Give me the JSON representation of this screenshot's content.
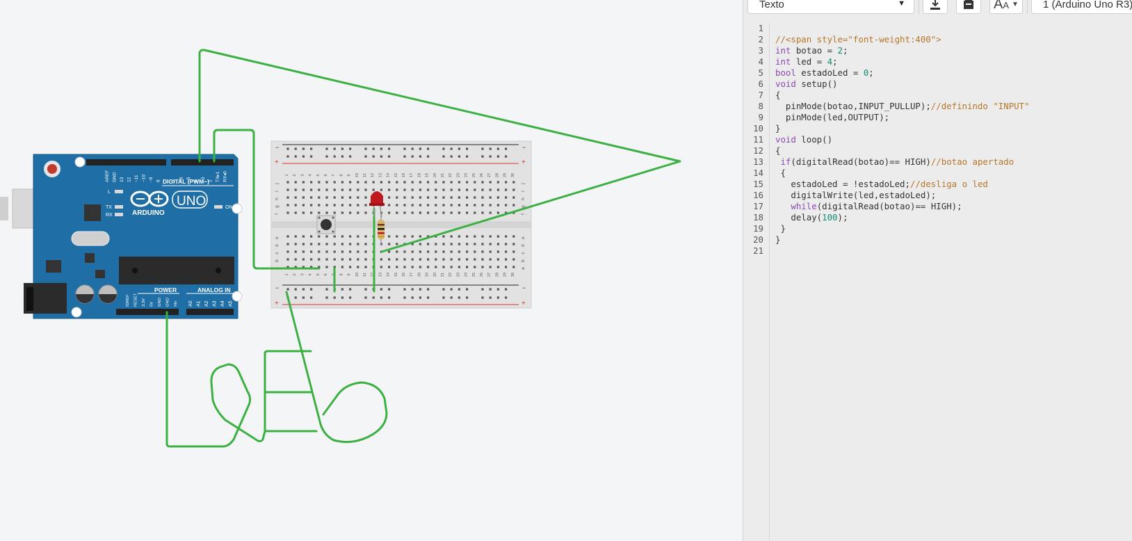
{
  "toolbar": {
    "mode_label": "Texto",
    "device_label": "1 (Arduino Uno R3)",
    "download_icon": "download-icon",
    "upload_icon": "upload-icon",
    "font_icon": "font-size-icon"
  },
  "arduino": {
    "brand": "ARDUINO",
    "model": "UNO",
    "digital_label": "DIGITAL (PWM~)",
    "power_label": "POWER",
    "analog_label": "ANALOG IN",
    "on_label": "ON",
    "l_label": "L",
    "tx_label": "TX",
    "rx_label": "RX",
    "digital_pins": [
      "AREF",
      "GND",
      "13",
      "12",
      "~11",
      "~10",
      "~9",
      "8",
      "7",
      "~6",
      "~5",
      "4",
      "~3",
      "2",
      "TX▸1",
      "RX◂0"
    ],
    "power_pins": [
      "IOREF",
      "RESET",
      "3.3V",
      "5V",
      "GND",
      "GND",
      "Vin"
    ],
    "analog_pins": [
      "A0",
      "A1",
      "A2",
      "A3",
      "A4",
      "A5"
    ]
  },
  "breadboard": {
    "column_numbers": [
      "1",
      "2",
      "3",
      "4",
      "5",
      "6",
      "7",
      "8",
      "9",
      "10",
      "11",
      "12",
      "13",
      "14",
      "15",
      "16",
      "17",
      "18",
      "19",
      "20",
      "21",
      "22",
      "23",
      "24",
      "25",
      "26",
      "27",
      "28",
      "29",
      "30"
    ],
    "top_rows": [
      "j",
      "i",
      "h",
      "g",
      "f"
    ],
    "bottom_rows": [
      "e",
      "d",
      "c",
      "b",
      "a"
    ],
    "plus_label": "+",
    "minus_label": "−"
  },
  "editor": {
    "line_numbers": [
      "1",
      "2",
      "3",
      "4",
      "5",
      "6",
      "7",
      "8",
      "9",
      "10",
      "11",
      "12",
      "13",
      "14",
      "15",
      "16",
      "17",
      "18",
      "19",
      "20",
      "21"
    ],
    "lines": [
      "",
      "//<span style=\"font-weight:400\">",
      "int botao = 2;",
      "int led = 4;",
      "bool estadoLed = 0;",
      "void setup()",
      "{",
      "  pinMode(botao,INPUT_PULLUP);//definindo \"INPUT\"",
      "  pinMode(led,OUTPUT);",
      "}",
      "void loop()",
      "{",
      " if(digitalRead(botao)== HIGH)//botao apertado",
      " {",
      "   estadoLed = !estadoLed;//desliga o led",
      "   digitalWrite(led,estadoLed);",
      "   while(digitalRead(botao)== HIGH);",
      "   delay(100);",
      " }",
      "}",
      ""
    ]
  },
  "colors": {
    "wire": "#3cb043",
    "arduino_blue": "#1f6fa6",
    "led_red": "#c0181f",
    "rail_red": "#d33",
    "keyword": "#8a4ab0",
    "number": "#0e8a72",
    "comment": "#b5762a"
  }
}
